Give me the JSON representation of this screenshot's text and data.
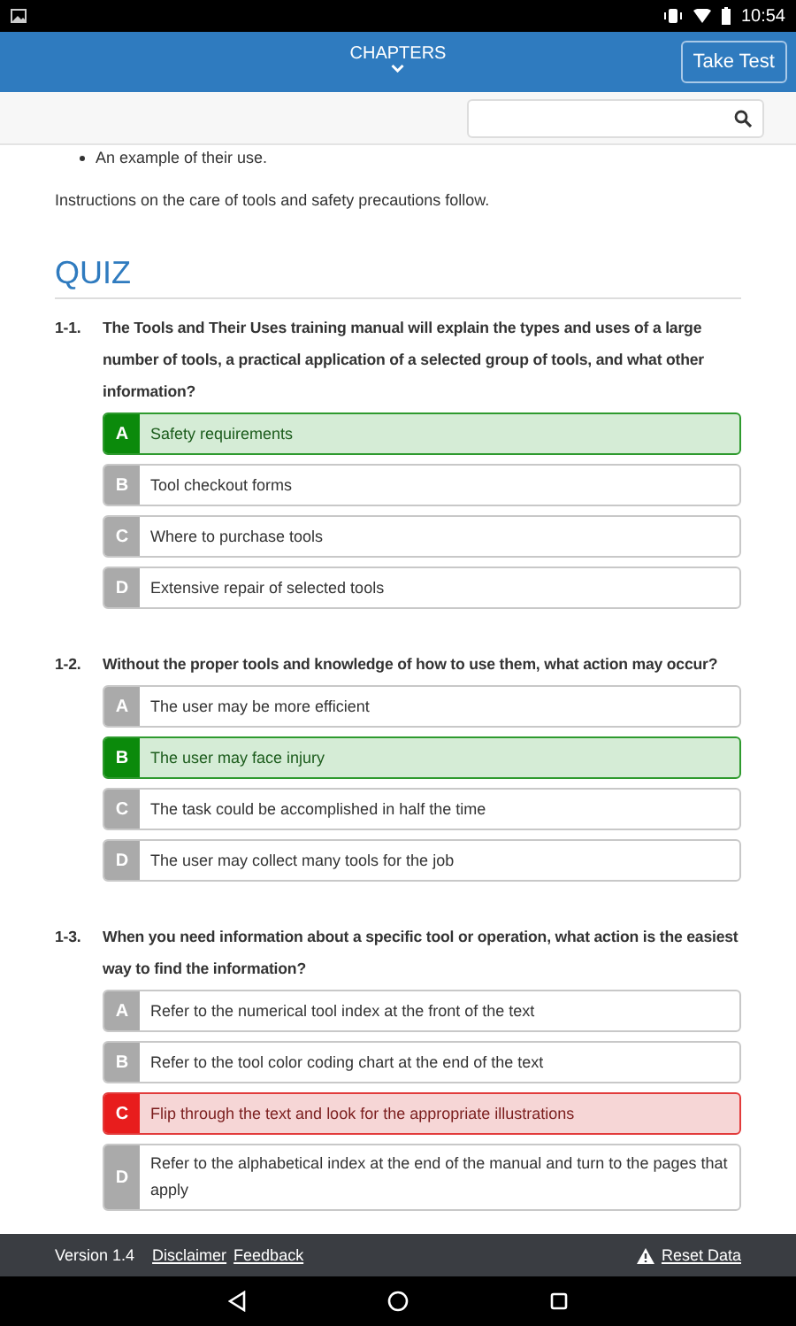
{
  "status_bar": {
    "time": "10:54"
  },
  "header": {
    "title": "CHAPTERS",
    "button": "Take Test"
  },
  "content": {
    "bullet": "An example of their use.",
    "paragraph": "Instructions on the care of tools and safety precautions follow."
  },
  "quiz": {
    "heading": "QUIZ",
    "questions": [
      {
        "number": "1-1.",
        "text": "The Tools and Their Uses training manual will explain the types and uses of a large number of tools, a practical application of a selected group of tools, and what other information?",
        "options": [
          {
            "letter": "A",
            "text": "Safety requirements",
            "kind": "correct"
          },
          {
            "letter": "B",
            "text": "Tool checkout forms",
            "kind": "plain"
          },
          {
            "letter": "C",
            "text": "Where to purchase tools",
            "kind": "plain"
          },
          {
            "letter": "D",
            "text": "Extensive repair of selected tools",
            "kind": "plain"
          }
        ]
      },
      {
        "number": "1-2.",
        "text": "Without the proper tools and knowledge of how to use them, what action may occur?",
        "options": [
          {
            "letter": "A",
            "text": "The user may be more efficient",
            "kind": "plain"
          },
          {
            "letter": "B",
            "text": "The user may face injury",
            "kind": "correct"
          },
          {
            "letter": "C",
            "text": "The task could be accomplished in half the time",
            "kind": "plain"
          },
          {
            "letter": "D",
            "text": "The user may collect many tools for the job",
            "kind": "plain"
          }
        ]
      },
      {
        "number": "1-3.",
        "text": "When you need information about a specific tool or operation, what action is the easiest way to find the information?",
        "options": [
          {
            "letter": "A",
            "text": "Refer to the numerical tool index at the front of the text",
            "kind": "plain"
          },
          {
            "letter": "B",
            "text": "Refer to the tool color coding chart at the end of the text",
            "kind": "plain"
          },
          {
            "letter": "C",
            "text": "Flip through the text and look for the appropriate illustrations",
            "kind": "wrong"
          },
          {
            "letter": "D",
            "text": "Refer to the alphabetical index at the end of the manual and turn to the pages that apply",
            "kind": "plain"
          }
        ]
      }
    ]
  },
  "footer": {
    "version": "Version 1.4",
    "links": [
      "Disclaimer",
      "Feedback"
    ],
    "reset": "Reset Data"
  }
}
